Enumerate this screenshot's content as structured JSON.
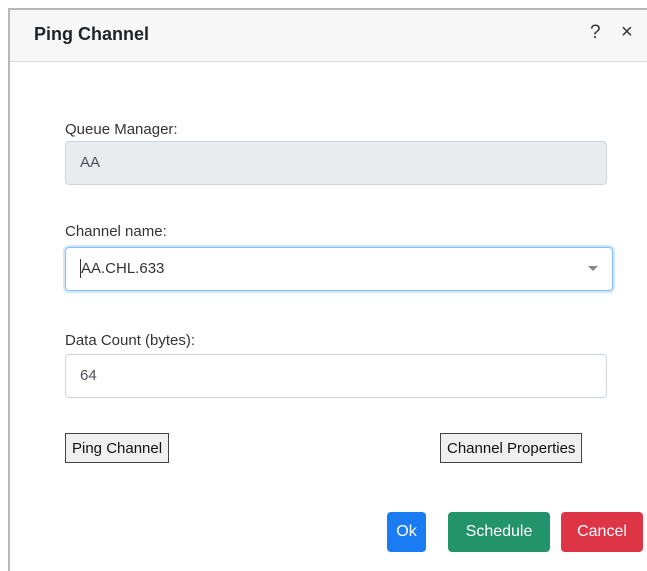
{
  "dialog": {
    "title": "Ping Channel",
    "help_icon": "?",
    "close_icon": "×"
  },
  "form": {
    "queue_manager_label": "Queue Manager:",
    "queue_manager_value": "AA",
    "channel_name_label": "Channel name:",
    "channel_name_value": "AA.CHL.633",
    "data_count_label": "Data Count (bytes):",
    "data_count_value": "64"
  },
  "buttons": {
    "ping_channel": "Ping Channel",
    "channel_properties": "Channel Properties",
    "ok": "Ok",
    "schedule": "Schedule",
    "cancel": "Cancel"
  },
  "colors": {
    "ok": "#1a7cf2",
    "schedule": "#22936a",
    "cancel": "#dd3545"
  }
}
